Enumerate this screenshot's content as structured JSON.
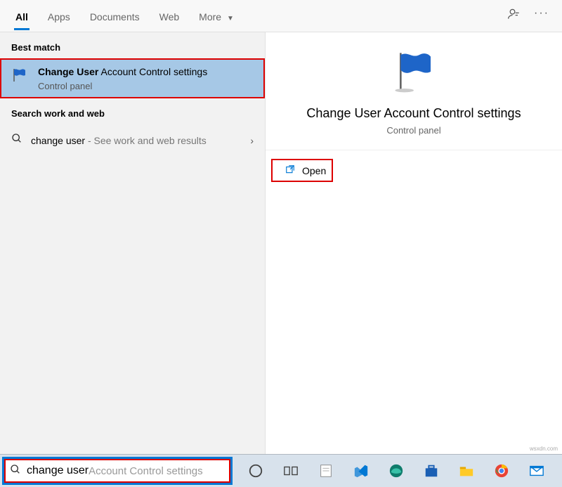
{
  "tabs": {
    "all": "All",
    "apps": "Apps",
    "documents": "Documents",
    "web": "Web",
    "more": "More"
  },
  "sections": {
    "best_match": "Best match",
    "search_work_web": "Search work and web"
  },
  "result": {
    "title_bold": "Change User",
    "title_rest": " Account Control settings",
    "subtitle": "Control panel"
  },
  "web_result": {
    "query": "change user",
    "hint": " - See work and web results"
  },
  "preview": {
    "title": "Change User Account Control settings",
    "subtitle": "Control panel",
    "open_label": "Open"
  },
  "search": {
    "typed": "change user",
    "completion": " Account Control settings"
  },
  "watermark": "wsxdn.com"
}
